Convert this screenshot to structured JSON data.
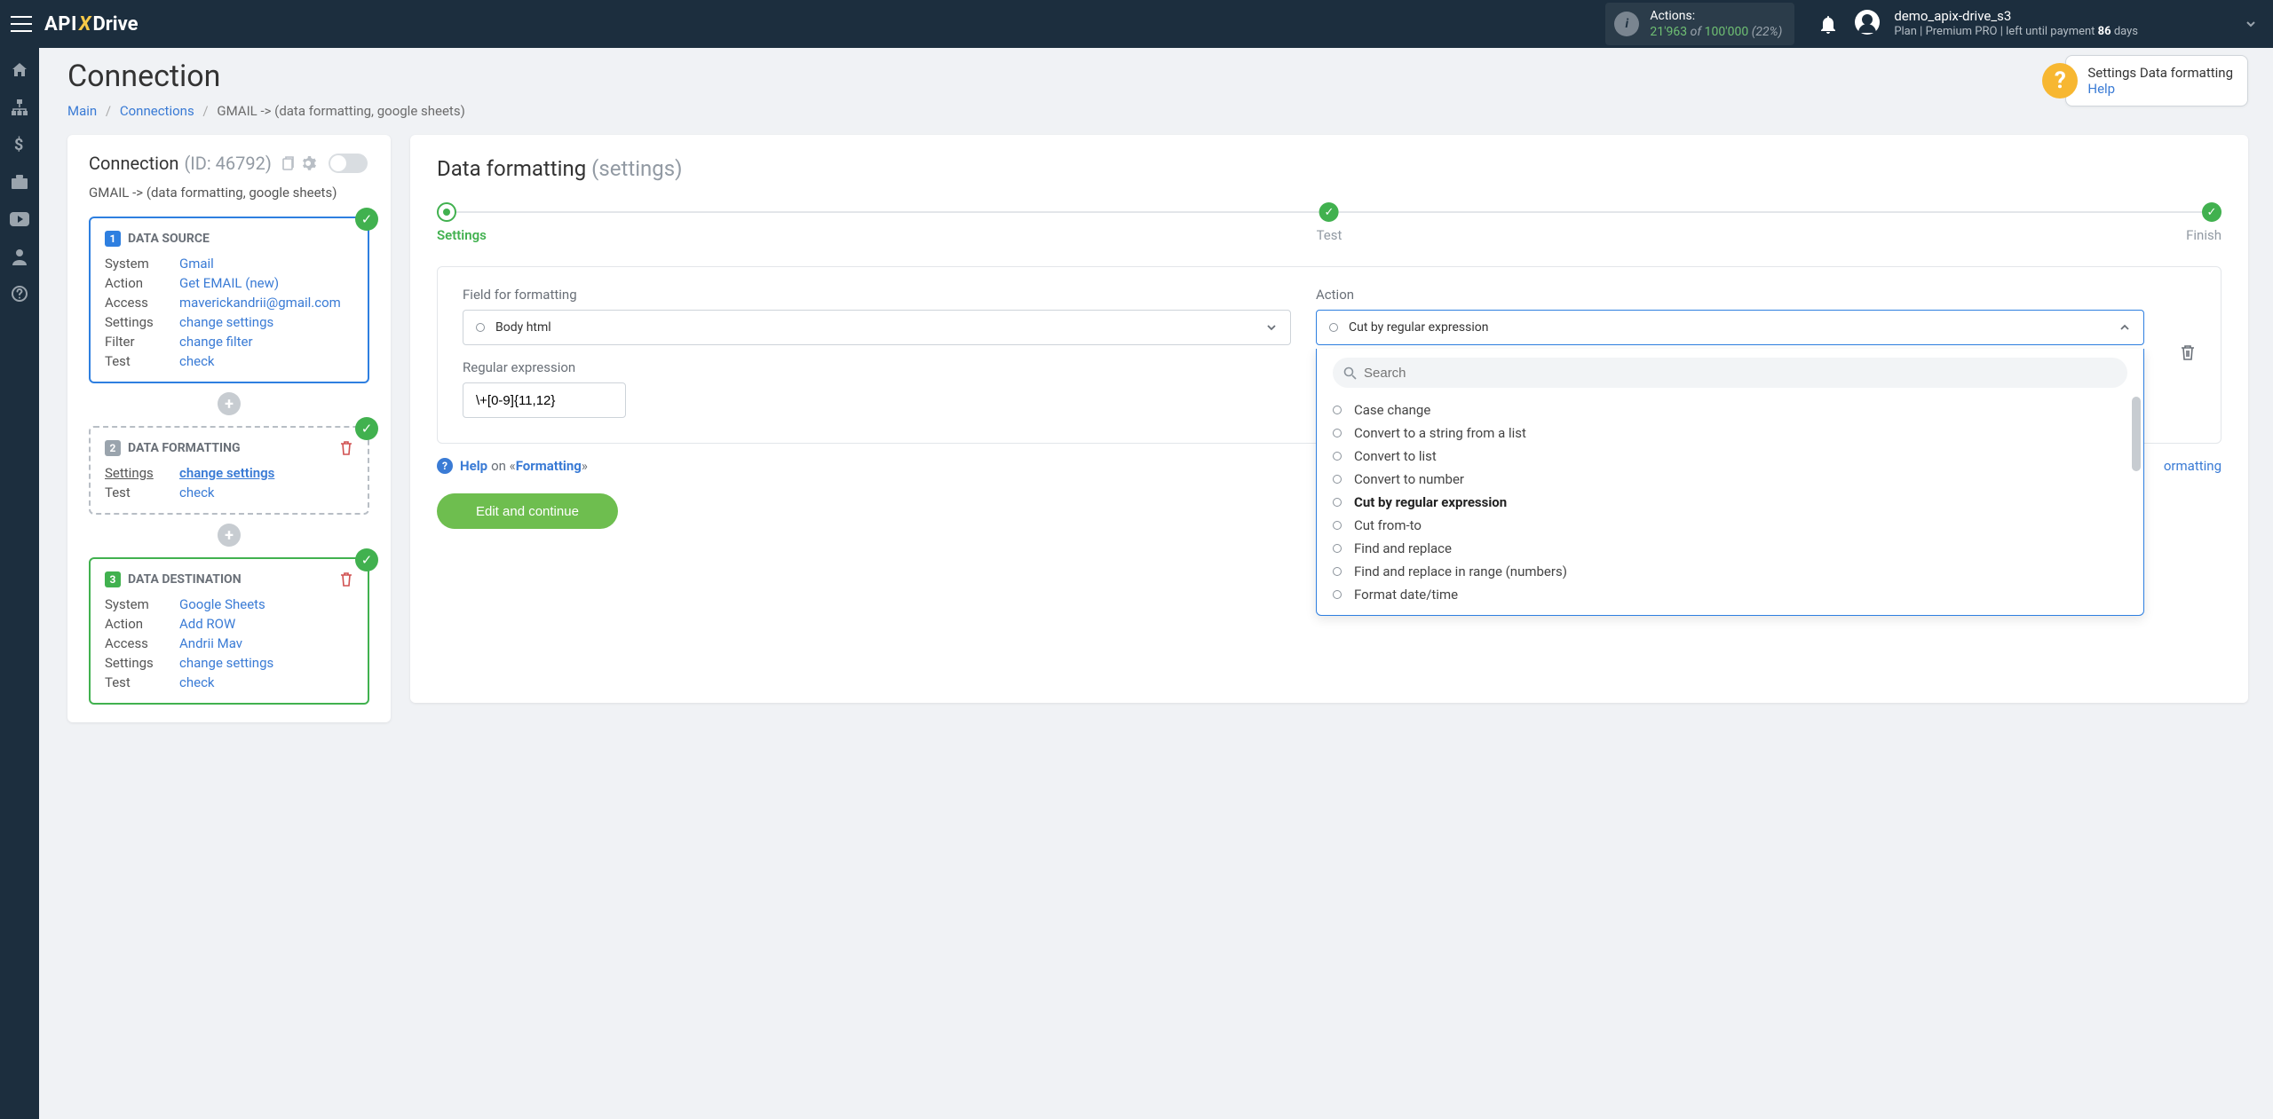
{
  "topbar": {
    "actions_label": "Actions:",
    "actions_used": "21'963",
    "actions_of": "of",
    "actions_total": "100'000",
    "actions_pct": "(22%)",
    "username": "demo_apix-drive_s3",
    "plan_prefix": "Plan |",
    "plan_name": "Premium PRO",
    "plan_suffix": "| left until payment",
    "plan_days": "86",
    "plan_days_word": "days"
  },
  "page": {
    "title": "Connection",
    "crumb_main": "Main",
    "crumb_connections": "Connections",
    "crumb_current": "GMAIL -> (data formatting, google sheets)"
  },
  "help_callout": {
    "title": "Settings Data formatting",
    "link": "Help"
  },
  "left_panel": {
    "header_word": "Connection",
    "header_id": "(ID: 46792)",
    "subtitle": "GMAIL -> (data formatting, google sheets)",
    "source": {
      "num": "1",
      "title": "DATA SOURCE",
      "rows": {
        "system_k": "System",
        "system_v": "Gmail",
        "action_k": "Action",
        "action_v": "Get EMAIL (new)",
        "access_k": "Access",
        "access_v": "maverickandrii@gmail.com",
        "settings_k": "Settings",
        "settings_v": "change settings",
        "filter_k": "Filter",
        "filter_v": "change filter",
        "test_k": "Test",
        "test_v": "check"
      }
    },
    "formatting": {
      "num": "2",
      "title": "DATA FORMATTING",
      "rows": {
        "settings_k": "Settings",
        "settings_v": "change settings",
        "test_k": "Test",
        "test_v": "check"
      }
    },
    "dest": {
      "num": "3",
      "title": "DATA DESTINATION",
      "rows": {
        "system_k": "System",
        "system_v": "Google Sheets",
        "action_k": "Action",
        "action_v": "Add ROW",
        "access_k": "Access",
        "access_v": "Andrii Mav",
        "settings_k": "Settings",
        "settings_v": "change settings",
        "test_k": "Test",
        "test_v": "check"
      }
    }
  },
  "right_panel": {
    "title_main": "Data formatting",
    "title_sub": "(settings)",
    "steps": {
      "s1": "Settings",
      "s2": "Test",
      "s3": "Finish"
    },
    "field_label": "Field for formatting",
    "field_value": "Body html",
    "action_label": "Action",
    "action_value": "Cut by regular expression",
    "regex_label": "Regular expression",
    "regex_value": "\\+[0-9]{11,12}",
    "search_placeholder": "Search",
    "options": [
      "Case change",
      "Convert to a string from a list",
      "Convert to list",
      "Convert to number",
      "Cut by regular expression",
      "Cut from-to",
      "Find and replace",
      "Find and replace in range (numbers)",
      "Format date/time"
    ],
    "help_word": "Help",
    "help_on": "on «",
    "help_topic": "Formatting",
    "help_close": "»",
    "add_format": "ormatting",
    "button": "Edit and continue"
  }
}
